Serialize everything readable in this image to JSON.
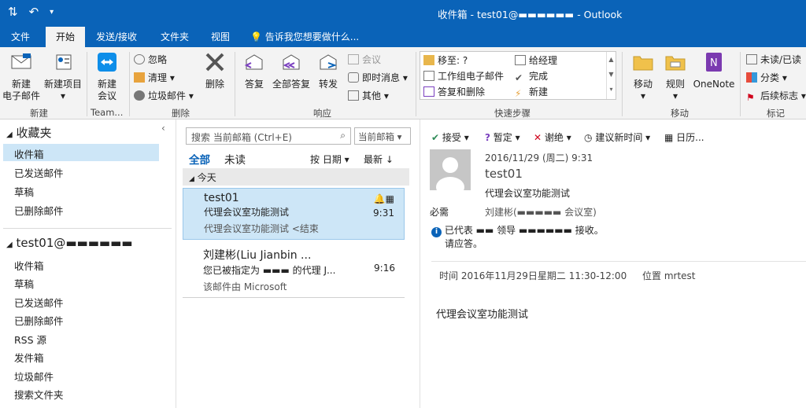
{
  "titlebar": {
    "title": "收件箱 - test01@▬▬▬▬▬▬ - Outlook"
  },
  "tabs": [
    "文件",
    "开始",
    "发送/接收",
    "文件夹",
    "视图"
  ],
  "tellme": "告诉我您想要做什么...",
  "ribbon": {
    "new_email": "新建\n电子邮件",
    "new_items": "新建项目",
    "new_meeting": "新建\n会议",
    "ignore": "忽略",
    "clean": "清理",
    "junk": "垃圾邮件",
    "delete": "删除",
    "reply": "答复",
    "reply_all": "全部答复",
    "forward": "转发",
    "meeting": "会议",
    "im": "即时消息",
    "more": "其他",
    "qs_move": "移至: ?",
    "qs_team": "工作组电子邮件",
    "qs_reply_del": "答复和删除",
    "qs_manager": "给经理",
    "qs_done": "完成",
    "qs_new": "新建",
    "move": "移动",
    "rules": "规则",
    "onenote": "OneNote",
    "unread_read": "未读/已读",
    "categorize": "分类",
    "followup": "后续标志",
    "groups": {
      "new": "新建",
      "team": "Team...",
      "delete": "删除",
      "respond": "响应",
      "quicksteps": "快速步骤",
      "move": "移动",
      "tags": "标记"
    }
  },
  "nav": {
    "favorites": "收藏夹",
    "fav_items": [
      "收件箱",
      "已发送邮件",
      "草稿",
      "已删除邮件"
    ],
    "account": "test01@▬▬▬▬▬▬",
    "acct_items": [
      "收件箱",
      "草稿",
      "已发送邮件",
      "已删除邮件",
      "RSS 源",
      "发件箱",
      "垃圾邮件",
      "搜索文件夹"
    ]
  },
  "list": {
    "search_placeholder": "搜索 当前邮箱 (Ctrl+E)",
    "scope": "当前邮箱",
    "all": "全部",
    "unread": "未读",
    "sort_by": "按 日期",
    "newest": "最新",
    "today": "今天",
    "messages": [
      {
        "from": "test01",
        "subject": "代理会议室功能测试",
        "preview": "代理会议室功能测试 <结束",
        "time": "9:31"
      },
      {
        "from": "刘建彬(Liu Jianbin ...",
        "subject": "您已被指定为 ▬▬▬ 的代理 J...",
        "preview": "该邮件由 Microsoft",
        "time": "9:16"
      }
    ]
  },
  "reading": {
    "actions": [
      "接受",
      "暂定",
      "谢绝",
      "建议新时间",
      "日历..."
    ],
    "datetime": "2016/11/29 (周二) 9:31",
    "sender": "test01",
    "subject": "代理会议室功能测试",
    "required_label": "必需",
    "required_value": "刘建彬(▬▬▬▬▬ 会议室)",
    "notice_line1": "已代表 ▬▬ 领导 ▬▬▬▬▬▬ 接收。",
    "notice_line2": "请应答。",
    "time_line": "时间 2016年11月29日星期二 11:30-12:00",
    "location": "位置 mrtest",
    "body": "代理会议室功能测试"
  },
  "colors": {
    "accent": "#0a63b8",
    "selection": "#cde6f7",
    "leader_red": "#d0021b"
  }
}
